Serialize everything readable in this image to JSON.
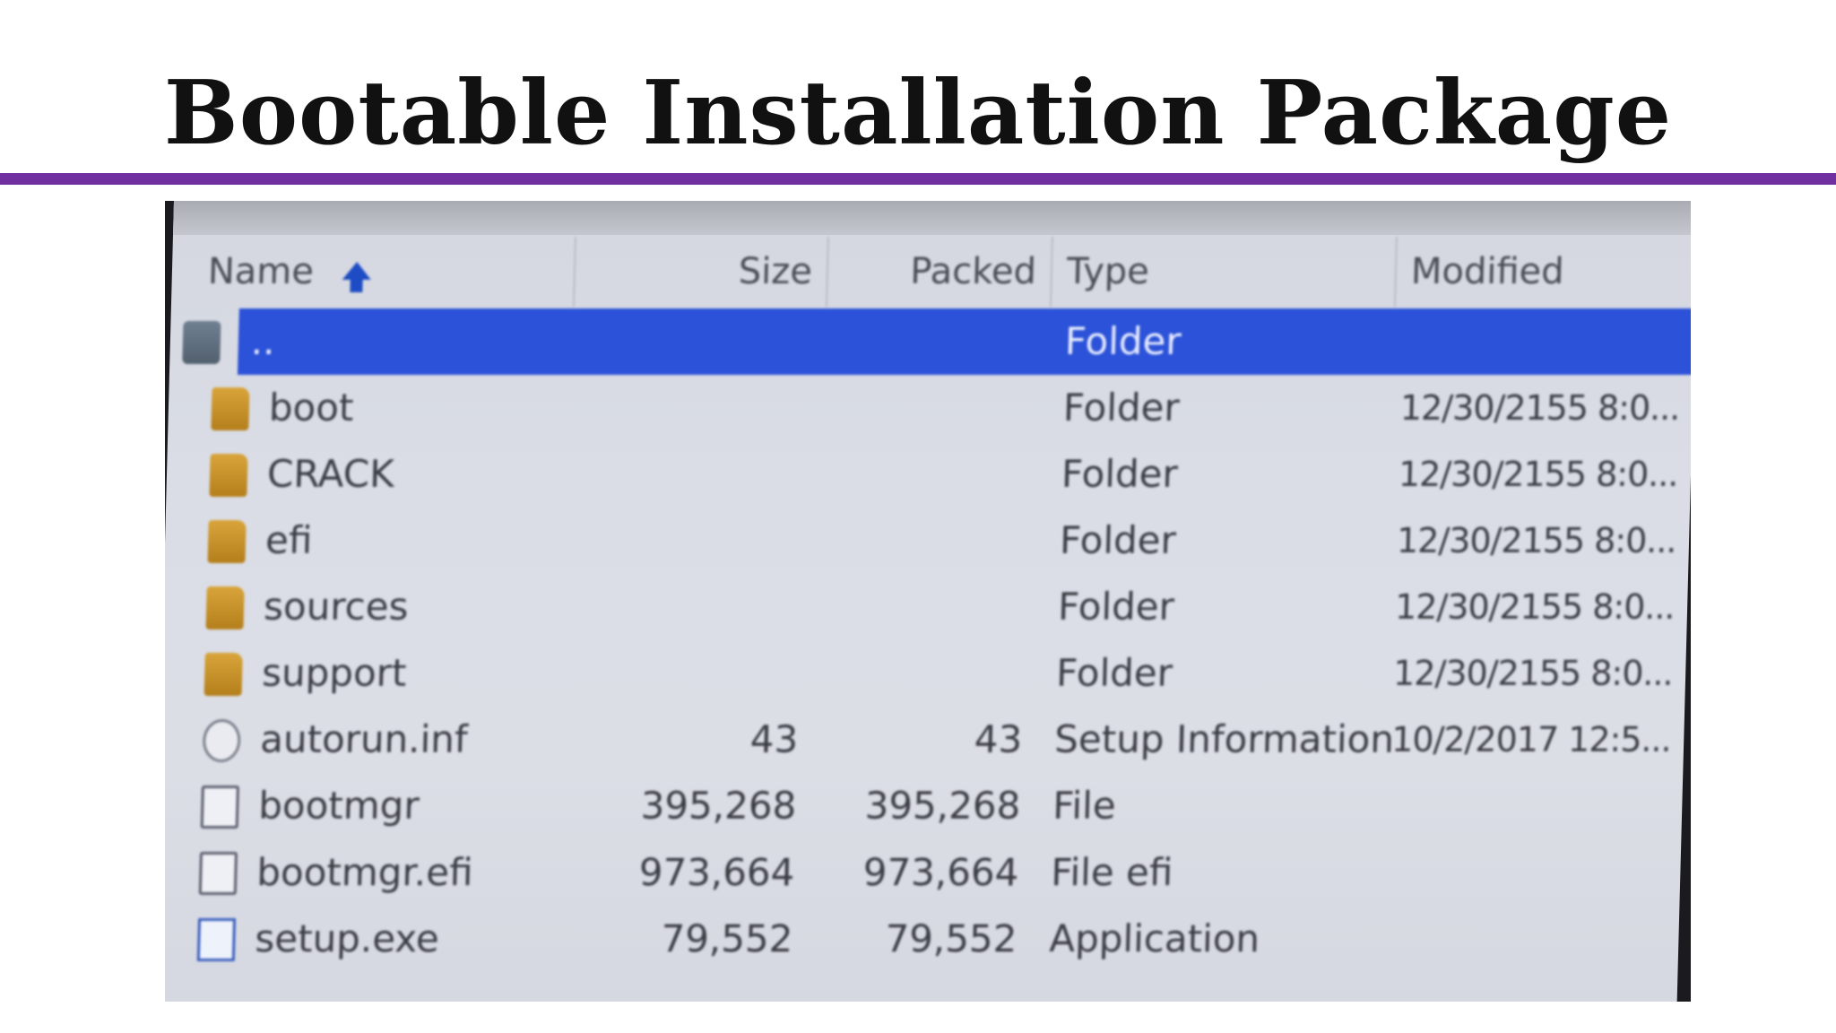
{
  "slide": {
    "title": "Bootable Installation Package",
    "rule_color": "#7030a0"
  },
  "archive_window": {
    "columns": {
      "name": "Name",
      "size": "Size",
      "packed": "Packed",
      "type": "Type",
      "modified": "Modified"
    },
    "sort_indicator_icon": "sort-ascending-arrow-icon",
    "selection_color": "#2b52d8",
    "rows": [
      {
        "icon": "parent-folder-icon",
        "name": "..",
        "size": "",
        "packed": "",
        "type": "Folder",
        "modified": "",
        "selected": true
      },
      {
        "icon": "folder-icon",
        "name": "boot",
        "size": "",
        "packed": "",
        "type": "Folder",
        "modified": "12/30/2155 8:0...",
        "selected": false
      },
      {
        "icon": "folder-icon",
        "name": "CRACK",
        "size": "",
        "packed": "",
        "type": "Folder",
        "modified": "12/30/2155 8:0...",
        "selected": false
      },
      {
        "icon": "folder-icon",
        "name": "efi",
        "size": "",
        "packed": "",
        "type": "Folder",
        "modified": "12/30/2155 8:0...",
        "selected": false
      },
      {
        "icon": "folder-icon",
        "name": "sources",
        "size": "",
        "packed": "",
        "type": "Folder",
        "modified": "12/30/2155 8:0...",
        "selected": false
      },
      {
        "icon": "folder-icon",
        "name": "support",
        "size": "",
        "packed": "",
        "type": "Folder",
        "modified": "12/30/2155 8:0...",
        "selected": false
      },
      {
        "icon": "settings-file-icon",
        "name": "autorun.inf",
        "size": "43",
        "packed": "43",
        "type": "Setup Information",
        "modified": "10/2/2017 12:5...",
        "selected": false
      },
      {
        "icon": "file-icon",
        "name": "bootmgr",
        "size": "395,268",
        "packed": "395,268",
        "type": "File",
        "modified": "",
        "selected": false
      },
      {
        "icon": "file-icon",
        "name": "bootmgr.efi",
        "size": "973,664",
        "packed": "973,664",
        "type": "File efi",
        "modified": "",
        "selected": false
      },
      {
        "icon": "application-icon",
        "name": "setup.exe",
        "size": "79,552",
        "packed": "79,552",
        "type": "Application",
        "modified": "",
        "selected": false
      }
    ]
  }
}
